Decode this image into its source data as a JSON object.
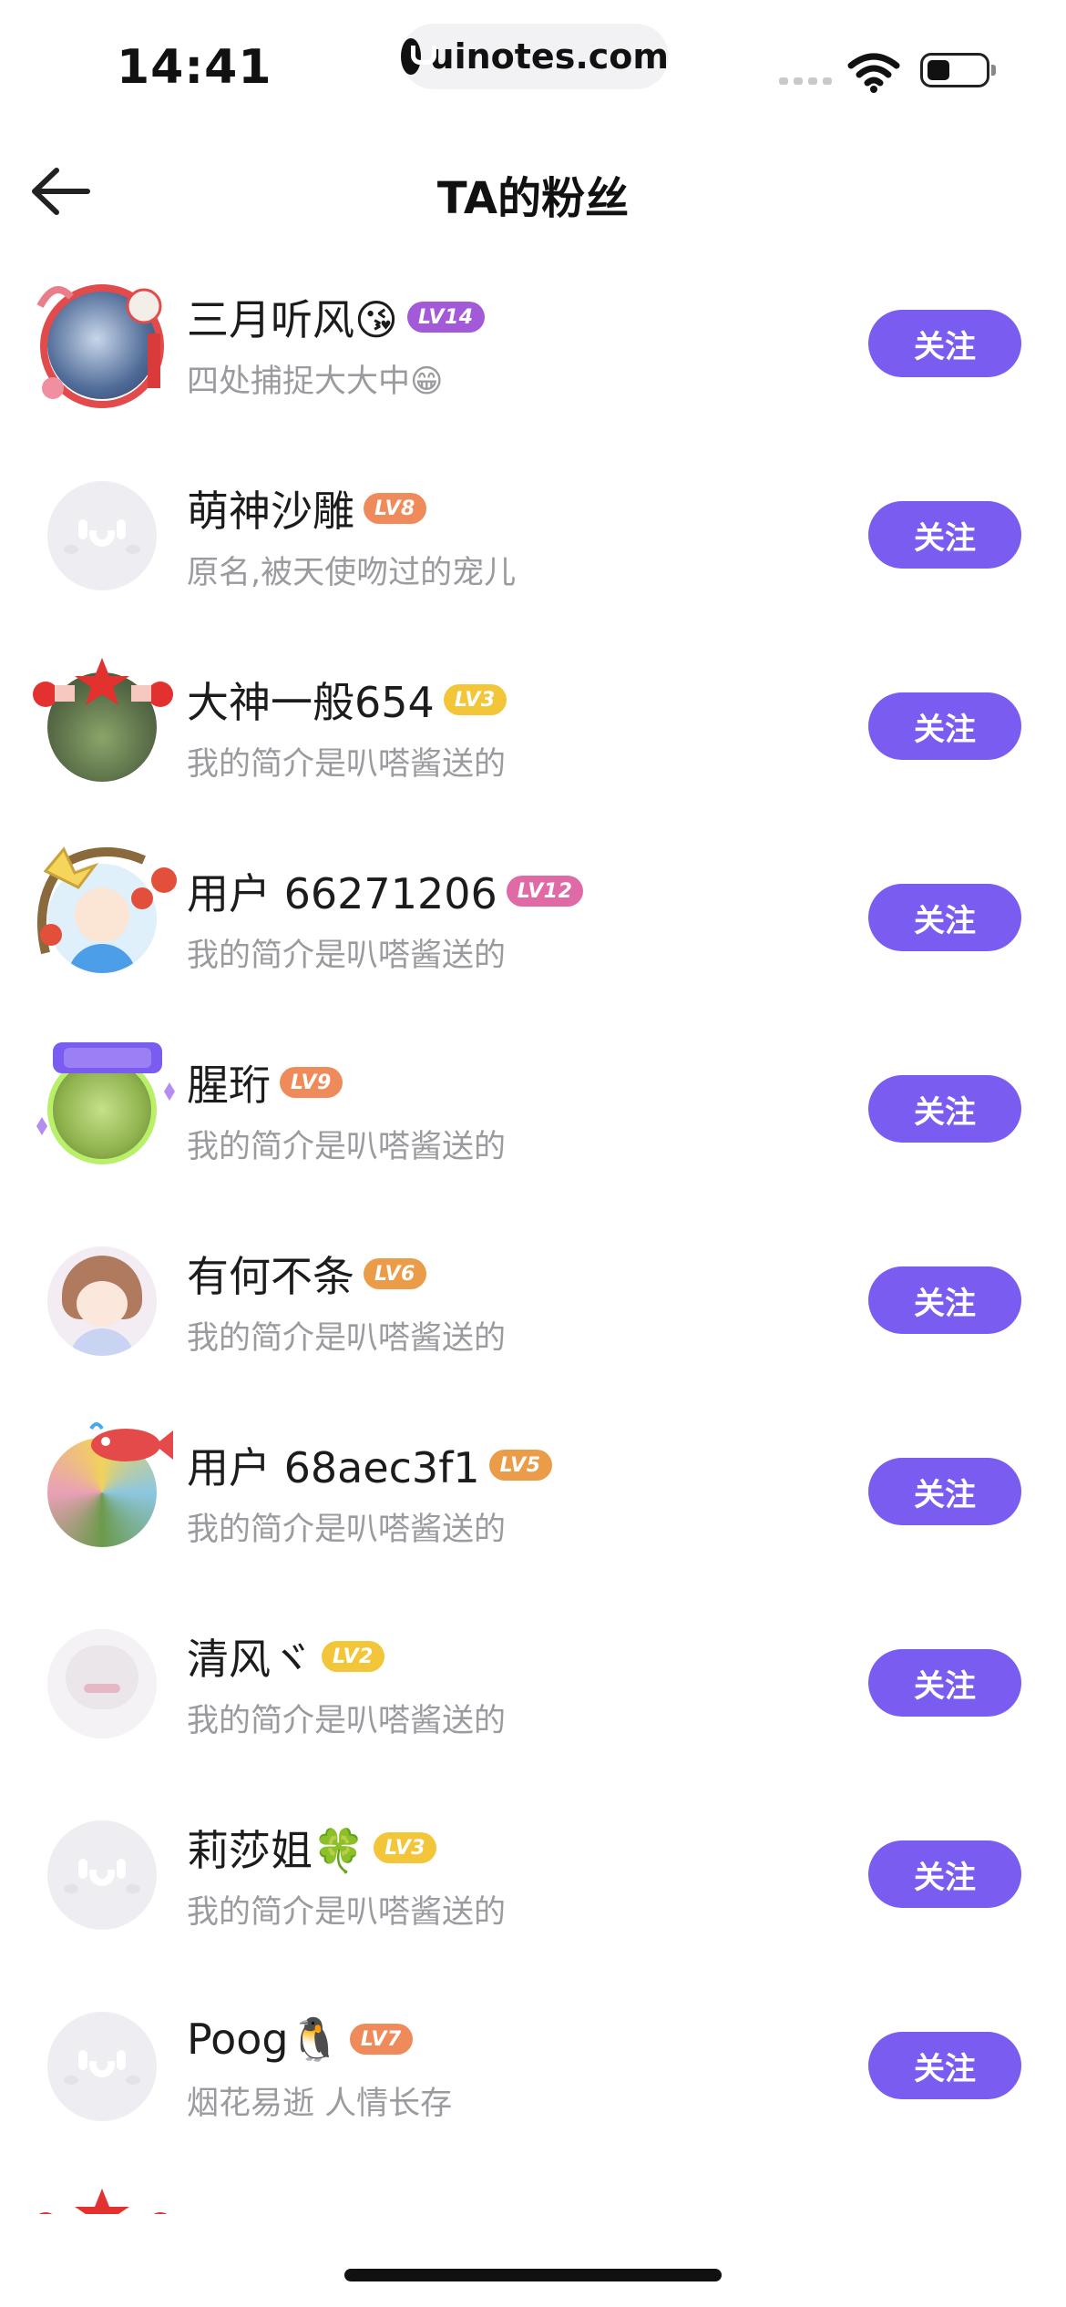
{
  "status_bar": {
    "time": "14:41",
    "url": "uinotes.com"
  },
  "nav": {
    "title": "TA的粉丝"
  },
  "colors": {
    "accent": "#7b5cf0"
  },
  "follow_label": "关注",
  "fans": [
    {
      "name": "三月听风😘",
      "level": "LV14",
      "level_color": "#a25ad8",
      "bio": "四处捕捉大大中😁",
      "avatar": "custom-blue"
    },
    {
      "name": "萌神沙雕",
      "level": "LV8",
      "level_color": "#ef8a5a",
      "bio": "原名,被天使吻过的宠儿",
      "avatar": "default"
    },
    {
      "name": "大神一般654",
      "level": "LV3",
      "level_color": "#f2c638",
      "bio": "我的简介是叭嗒酱送的",
      "avatar": "custom-green"
    },
    {
      "name": "用户 66271206",
      "level": "LV12",
      "level_color": "#e06aa6",
      "bio": "我的简介是叭嗒酱送的",
      "avatar": "custom-cartoon"
    },
    {
      "name": "腥珩",
      "level": "LV9",
      "level_color": "#ef8a5a",
      "bio": "我的简介是叭嗒酱送的",
      "avatar": "custom-lime"
    },
    {
      "name": "有何不条",
      "level": "LV6",
      "level_color": "#eb9c48",
      "bio": "我的简介是叭嗒酱送的",
      "avatar": "custom-anime"
    },
    {
      "name": "用户 68aec3f1",
      "level": "LV5",
      "level_color": "#eb9c48",
      "bio": "我的简介是叭嗒酱送的",
      "avatar": "custom-colorful"
    },
    {
      "name": "清风ヾ",
      "level": "LV2",
      "level_color": "#f2c638",
      "bio": "我的简介是叭嗒酱送的",
      "avatar": "custom-faint"
    },
    {
      "name": "莉莎姐🍀",
      "level": "LV3",
      "level_color": "#f2c638",
      "bio": "我的简介是叭嗒酱送的",
      "avatar": "default"
    },
    {
      "name": "Poog🐧",
      "level": "LV7",
      "level_color": "#ef8a5a",
      "bio": "烟花易逝 人情长存",
      "avatar": "default"
    }
  ]
}
